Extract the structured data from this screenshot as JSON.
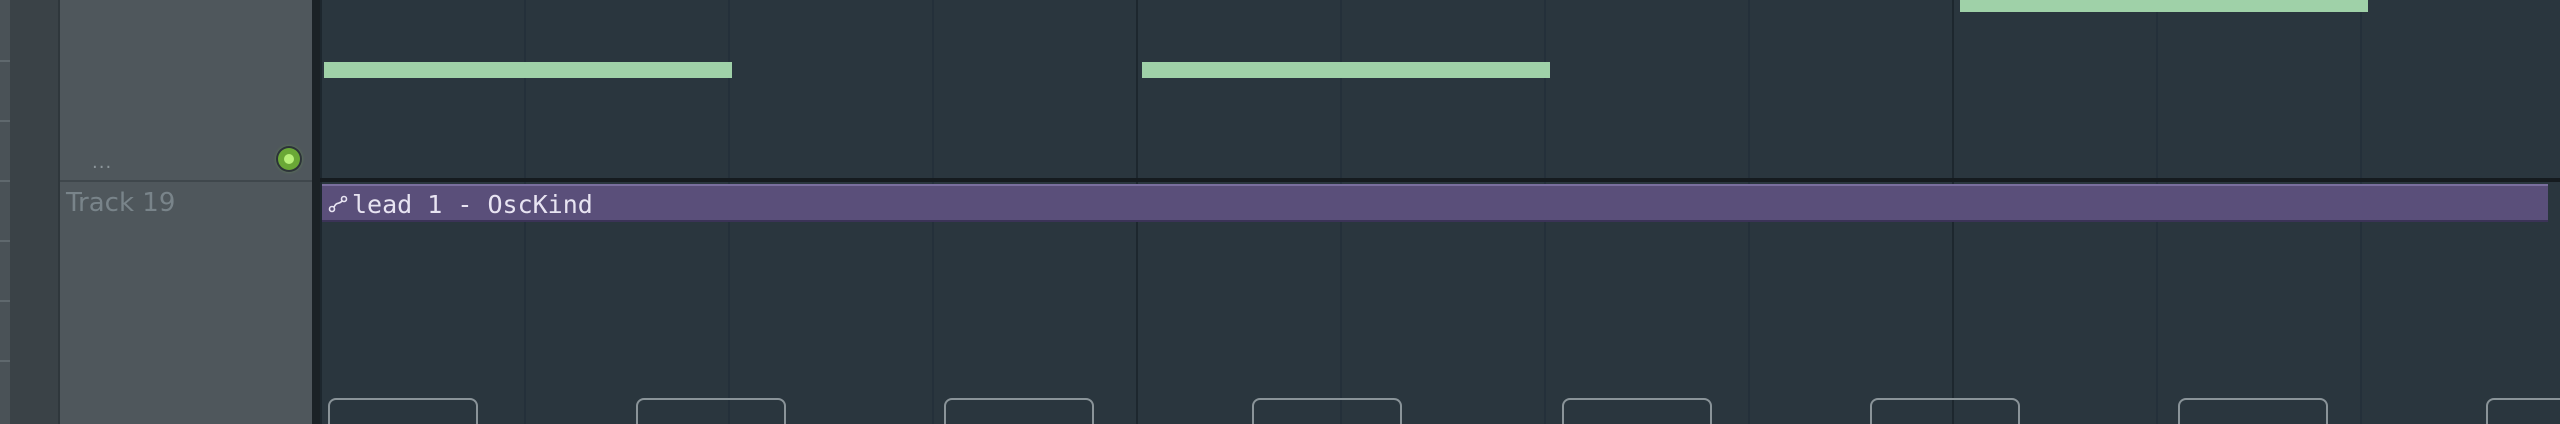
{
  "track": {
    "menu_dots": "...",
    "name": "Track 19"
  },
  "clip": {
    "label": "lead 1 - OscKind",
    "icon": "automation-curve-icon",
    "color": "#5a4f7a"
  },
  "colors": {
    "note": "#9fd1a8",
    "playlist_bg": "#2a363e",
    "header_bg": "#4f575c",
    "led": "#6aa836"
  }
}
